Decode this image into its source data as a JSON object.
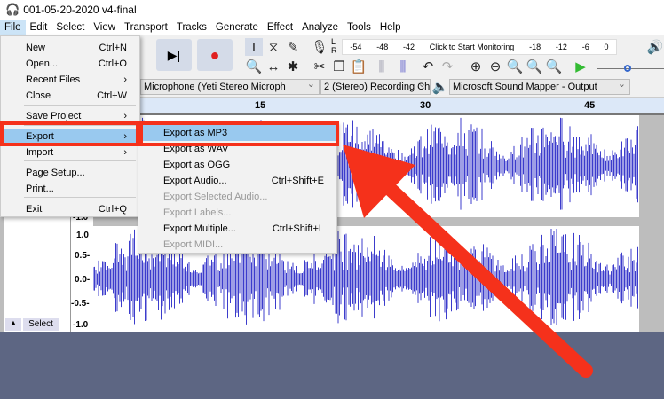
{
  "window": {
    "title": "001-05-20-2020 v4-final"
  },
  "menubar": [
    "File",
    "Edit",
    "Select",
    "View",
    "Transport",
    "Tracks",
    "Generate",
    "Effect",
    "Analyze",
    "Tools",
    "Help"
  ],
  "file_menu": [
    {
      "label": "New",
      "shortcut": "Ctrl+N"
    },
    {
      "label": "Open...",
      "shortcut": "Ctrl+O"
    },
    {
      "label": "Recent Files",
      "shortcut": "›"
    },
    {
      "label": "Close",
      "shortcut": "Ctrl+W"
    },
    {
      "label": "Save Project",
      "shortcut": "›"
    },
    {
      "label": "Export",
      "shortcut": "›"
    },
    {
      "label": "Import",
      "shortcut": "›"
    },
    {
      "label": "Page Setup...",
      "shortcut": ""
    },
    {
      "label": "Print...",
      "shortcut": ""
    },
    {
      "label": "Exit",
      "shortcut": "Ctrl+Q"
    }
  ],
  "export_menu": [
    {
      "label": "Export as MP3",
      "shortcut": "",
      "enabled": true
    },
    {
      "label": "Export as WAV",
      "shortcut": "",
      "enabled": true
    },
    {
      "label": "Export as OGG",
      "shortcut": "",
      "enabled": true
    },
    {
      "label": "Export Audio...",
      "shortcut": "Ctrl+Shift+E",
      "enabled": true
    },
    {
      "label": "Export Selected Audio...",
      "shortcut": "",
      "enabled": false
    },
    {
      "label": "Export Labels...",
      "shortcut": "",
      "enabled": false
    },
    {
      "label": "Export Multiple...",
      "shortcut": "Ctrl+Shift+L",
      "enabled": true
    },
    {
      "label": "Export MIDI...",
      "shortcut": "",
      "enabled": false
    }
  ],
  "meter": {
    "labels": [
      "-54",
      "-48",
      "-42",
      "Click to Start Monitoring",
      "-18",
      "-12",
      "-6",
      "0"
    ],
    "lr": [
      "L",
      "R"
    ]
  },
  "devices": {
    "input": "Microphone (Yeti Stereo Microph",
    "channels": "2 (Stereo) Recording Cha",
    "output": "Microsoft Sound Mapper - Output"
  },
  "ruler": [
    "15",
    "30",
    "45"
  ],
  "scale": {
    "top": "-1.0",
    "ch2": [
      "1.0",
      "0.5-",
      "0.0-",
      "-0.5-",
      "-1.0"
    ]
  },
  "track": {
    "select_label": "Select"
  },
  "colors": {
    "waveform": "#3c3ccc",
    "highlight": "#f5311b",
    "menu_highlight": "#99c9ef"
  }
}
